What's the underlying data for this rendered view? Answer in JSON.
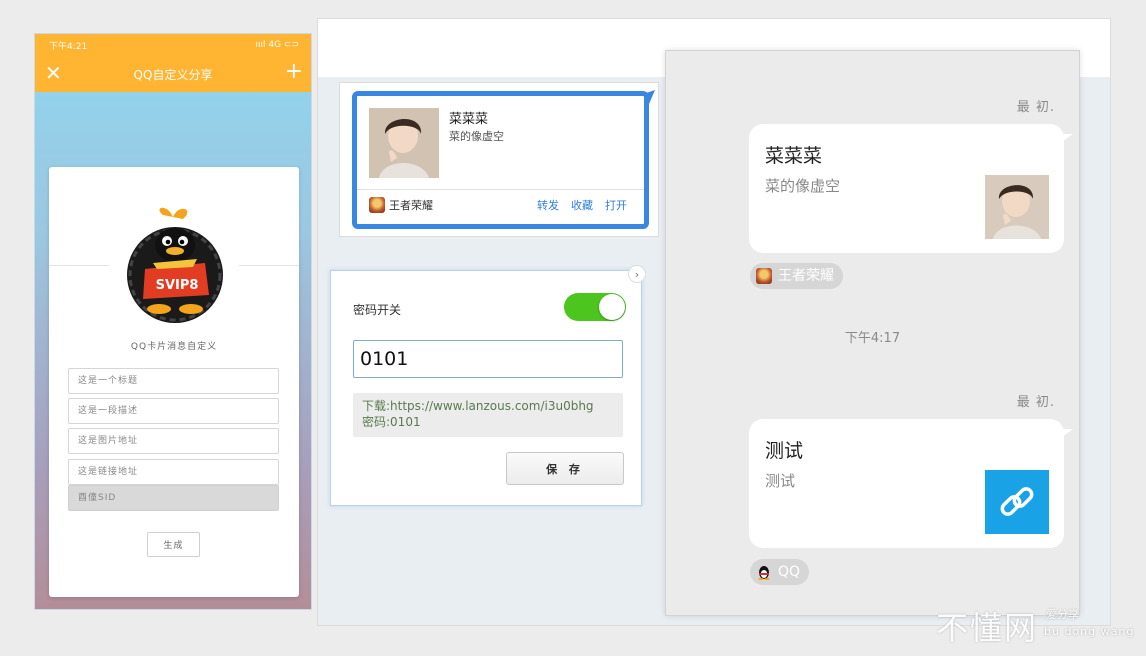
{
  "phone": {
    "status_time": "下午4:21",
    "status_right": "ıııl 4G ⊂⊃",
    "title": "QQ自定义分享",
    "close_glyph": "✕",
    "add_glyph": "+",
    "card_subtitle": "QQ卡片消息自定义",
    "fields": [
      "这是一个标题",
      "这是一段描述",
      "这是图片地址",
      "这是链接地址",
      "酉僮SID"
    ],
    "generate_label": "生成"
  },
  "share_card": {
    "name": "菜菜菜",
    "desc": "菜的像虚空",
    "source": "王者荣耀",
    "actions": [
      "转发",
      "收藏",
      "打开"
    ]
  },
  "password_panel": {
    "label": "密码开关",
    "toggle_on": true,
    "input_value": "0101",
    "note_line1": "下载:https://www.lanzous.com/i3u0bhg",
    "note_line2": "密码:0101",
    "save_label": "保 存",
    "close_glyph": "›"
  },
  "chat": {
    "messages": [
      {
        "sender": "最 初.",
        "title": "菜菜菜",
        "desc": "菜的像虚空",
        "source": "王者荣耀",
        "thumb": "portrait"
      },
      {
        "sender": "最 初.",
        "title": "测试",
        "desc": "测试",
        "source": "QQ",
        "thumb": "link-icon"
      }
    ],
    "time": "下午4:17"
  },
  "watermark": {
    "main": "不懂网",
    "sub1": "爱分享",
    "sub2": "bu dong wang"
  },
  "colors": {
    "accent_orange": "#ffb432",
    "card_blue": "#3a86e3",
    "toggle_green": "#4cc51f",
    "link_tile": "#19a3e6"
  }
}
